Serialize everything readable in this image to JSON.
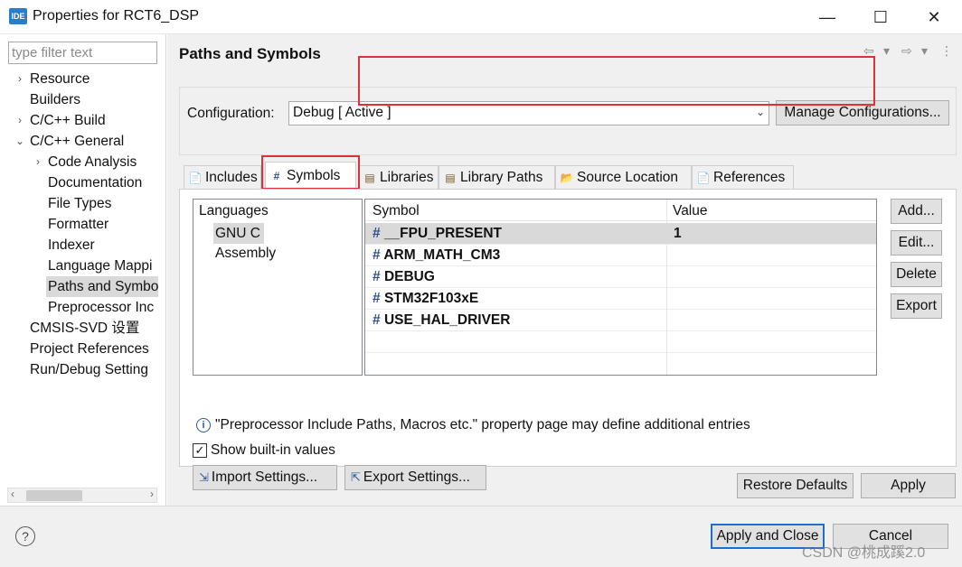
{
  "window": {
    "app_icon_text": "IDE",
    "title": "Properties for RCT6_DSP",
    "minimize": "—",
    "maximize": "☐",
    "close": "✕"
  },
  "filter": {
    "placeholder": "type filter text"
  },
  "tree": {
    "items": [
      {
        "label": "Resource",
        "arrow": "›"
      },
      {
        "label": "Builders",
        "arrow": ""
      },
      {
        "label": "C/C++ Build",
        "arrow": "›"
      },
      {
        "label": "C/C++ General",
        "arrow": "⌄"
      },
      {
        "label": "Code Analysis",
        "arrow": "›"
      },
      {
        "label": "Documentation",
        "arrow": ""
      },
      {
        "label": "File Types",
        "arrow": ""
      },
      {
        "label": "Formatter",
        "arrow": ""
      },
      {
        "label": "Indexer",
        "arrow": ""
      },
      {
        "label": "Language Mappi",
        "arrow": ""
      },
      {
        "label": "Paths and Symbo",
        "arrow": ""
      },
      {
        "label": "Preprocessor Inc",
        "arrow": ""
      },
      {
        "label": "CMSIS-SVD 设置",
        "arrow": ""
      },
      {
        "label": "Project References",
        "arrow": ""
      },
      {
        "label": "Run/Debug Setting",
        "arrow": ""
      }
    ],
    "scroll_left": "‹",
    "scroll_right": "›"
  },
  "page": {
    "title": "Paths and Symbols",
    "nav_back": "⇦",
    "nav_forward": "⇨",
    "nav_dropdown": "▾",
    "nav_menu": "⋮"
  },
  "config": {
    "label": "Configuration:",
    "selected": "Debug  [ Active ]",
    "manage_button": "Manage Configurations..."
  },
  "tabs": [
    {
      "label": "Includes",
      "icon": "📄"
    },
    {
      "label": "Symbols",
      "icon": "#"
    },
    {
      "label": "Libraries",
      "icon": "▤"
    },
    {
      "label": "Library Paths",
      "icon": "▤"
    },
    {
      "label": "Source Location",
      "icon": "📂"
    },
    {
      "label": "References",
      "icon": "📄"
    }
  ],
  "languages": {
    "header": "Languages",
    "items": [
      "GNU C",
      "Assembly"
    ]
  },
  "symbols_table": {
    "columns": [
      "Symbol",
      "Value"
    ],
    "rows": [
      {
        "symbol": "__FPU_PRESENT",
        "value": "1"
      },
      {
        "symbol": "ARM_MATH_CM3",
        "value": ""
      },
      {
        "symbol": "DEBUG",
        "value": ""
      },
      {
        "symbol": "STM32F103xE",
        "value": ""
      },
      {
        "symbol": "USE_HAL_DRIVER",
        "value": ""
      }
    ],
    "hash": "#"
  },
  "side_buttons": {
    "add": "Add...",
    "edit": "Edit...",
    "delete": "Delete",
    "export": "Export"
  },
  "info": {
    "icon": "i",
    "text": "\"Preprocessor Include Paths, Macros etc.\" property page may define additional entries"
  },
  "builtin": {
    "checked": "✓",
    "label": "Show built-in values"
  },
  "settings": {
    "import": "Import Settings...",
    "export": "Export Settings..."
  },
  "bottom_buttons": {
    "restore": "Restore Defaults",
    "apply": "Apply"
  },
  "footer": {
    "help": "?",
    "apply_close": "Apply and Close",
    "cancel": "Cancel"
  },
  "watermark": "CSDN @桃成蹊2.0"
}
